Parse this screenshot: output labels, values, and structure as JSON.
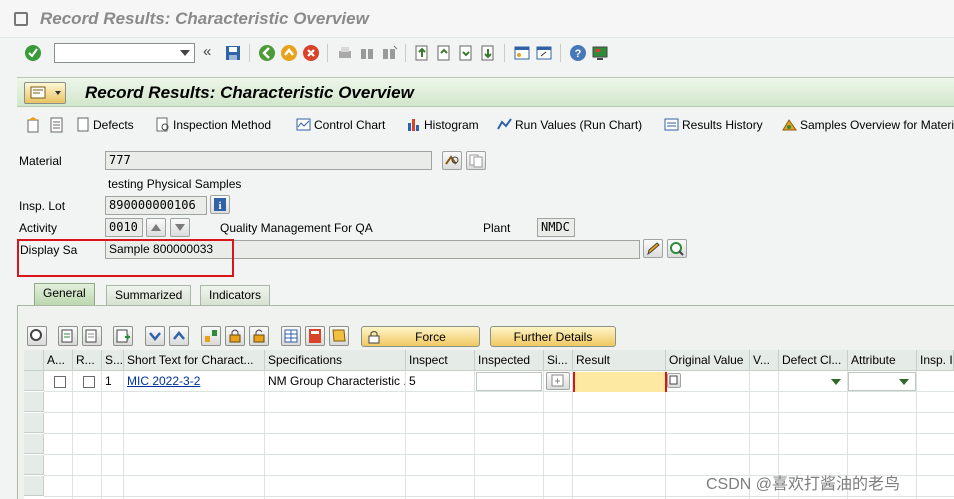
{
  "window": {
    "title": "Record Results: Characteristic Overview"
  },
  "system_toolbar": {
    "command_field_value": "",
    "icons": [
      "enter-icon",
      "command-dropdown-icon",
      "back-arrows-icon",
      "save-icon",
      "back-icon",
      "exit-icon",
      "cancel-icon",
      "print-icon",
      "find-icon",
      "find-next-icon",
      "first-page-icon",
      "previous-page-icon",
      "next-page-icon",
      "last-page-icon",
      "new-session-icon",
      "shortcut-icon",
      "help-icon",
      "customize-layout-icon"
    ]
  },
  "header": {
    "title": "Record Results: Characteristic Overview"
  },
  "app_toolbar": {
    "buttons": [
      {
        "label": "Defects",
        "icon": "defects-icon"
      },
      {
        "label": "Inspection Method",
        "icon": "inspection-method-icon"
      },
      {
        "label": "Control Chart",
        "icon": "control-chart-icon"
      },
      {
        "label": "Histogram",
        "icon": "histogram-icon"
      },
      {
        "label": "Run Values (Run Chart)",
        "icon": "run-chart-icon"
      },
      {
        "label": "Results History",
        "icon": "results-history-icon"
      },
      {
        "label": "Samples Overview for Materi",
        "icon": "samples-overview-icon"
      }
    ]
  },
  "form": {
    "material_label": "Material",
    "material_value": "777",
    "material_description": "testing Physical Samples",
    "insp_lot_label": "Insp. Lot",
    "insp_lot_value": "890000000106",
    "activity_label": "Activity",
    "activity_value": "0010",
    "activity_text": "Quality Management For QA",
    "plant_label": "Plant",
    "plant_value": "NMDC",
    "display_sample_label": "Display Sa",
    "display_sample_value": "Sample 800000033"
  },
  "tabs": [
    {
      "label": "General",
      "active": true
    },
    {
      "label": "Summarized",
      "active": false
    },
    {
      "label": "Indicators",
      "active": false
    }
  ],
  "grid_toolbar": {
    "force_label": "Force",
    "further_details_label": "Further Details"
  },
  "grid": {
    "columns": [
      "A...",
      "R...",
      "S...",
      "Short Text for Charact...",
      "Specifications",
      "Inspect",
      "Inspected",
      "Si...",
      "Result",
      "Original Value",
      "V...",
      "Defect Cl...",
      "Attribute",
      "Insp. I"
    ],
    "rows": [
      {
        "seq": "1",
        "short_text": "MIC 2022-3-2",
        "specifications": "NM Group Characteristic ...",
        "inspect": "5",
        "inspected": "",
        "result": "",
        "original_value": "",
        "defect_class": "",
        "attribute": ""
      }
    ]
  },
  "watermark": "CSDN @喜欢打酱油的老鸟",
  "colors": {
    "header_bg": "#d2e6cb",
    "required_marker": "#d9141a",
    "result_field": "#fde9a2",
    "tab_active": "#bcd7b0"
  }
}
